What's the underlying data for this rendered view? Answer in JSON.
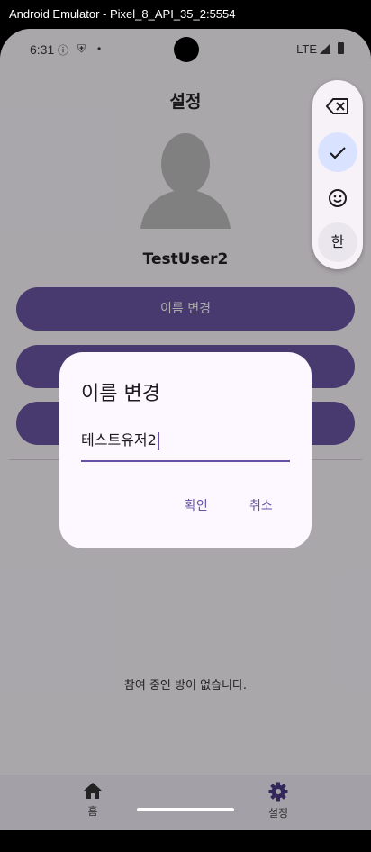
{
  "window": {
    "title": "Android Emulator - Pixel_8_API_35_2:5554"
  },
  "statusbar": {
    "time": "6:31",
    "network": "LTE"
  },
  "settings": {
    "title": "설정",
    "username": "TestUser2",
    "change_name_label": "이름 변경",
    "empty_rooms_text": "참여 중인 방이 없습니다."
  },
  "bottom_nav": {
    "items": [
      {
        "label": "홈",
        "icon": "home-icon"
      },
      {
        "label": "설정",
        "icon": "gear-icon"
      }
    ]
  },
  "dialog": {
    "title": "이름 변경",
    "input_value": "테스트유저2",
    "confirm_label": "확인",
    "cancel_label": "취소"
  },
  "ime_toolbar": {
    "buttons": [
      "backspace-icon",
      "check-icon",
      "emoji-icon",
      "한"
    ],
    "lang_label": "한"
  },
  "colors": {
    "accent": "#6750a4",
    "button_bg": "#6a55a4",
    "scrim": "#000000"
  }
}
